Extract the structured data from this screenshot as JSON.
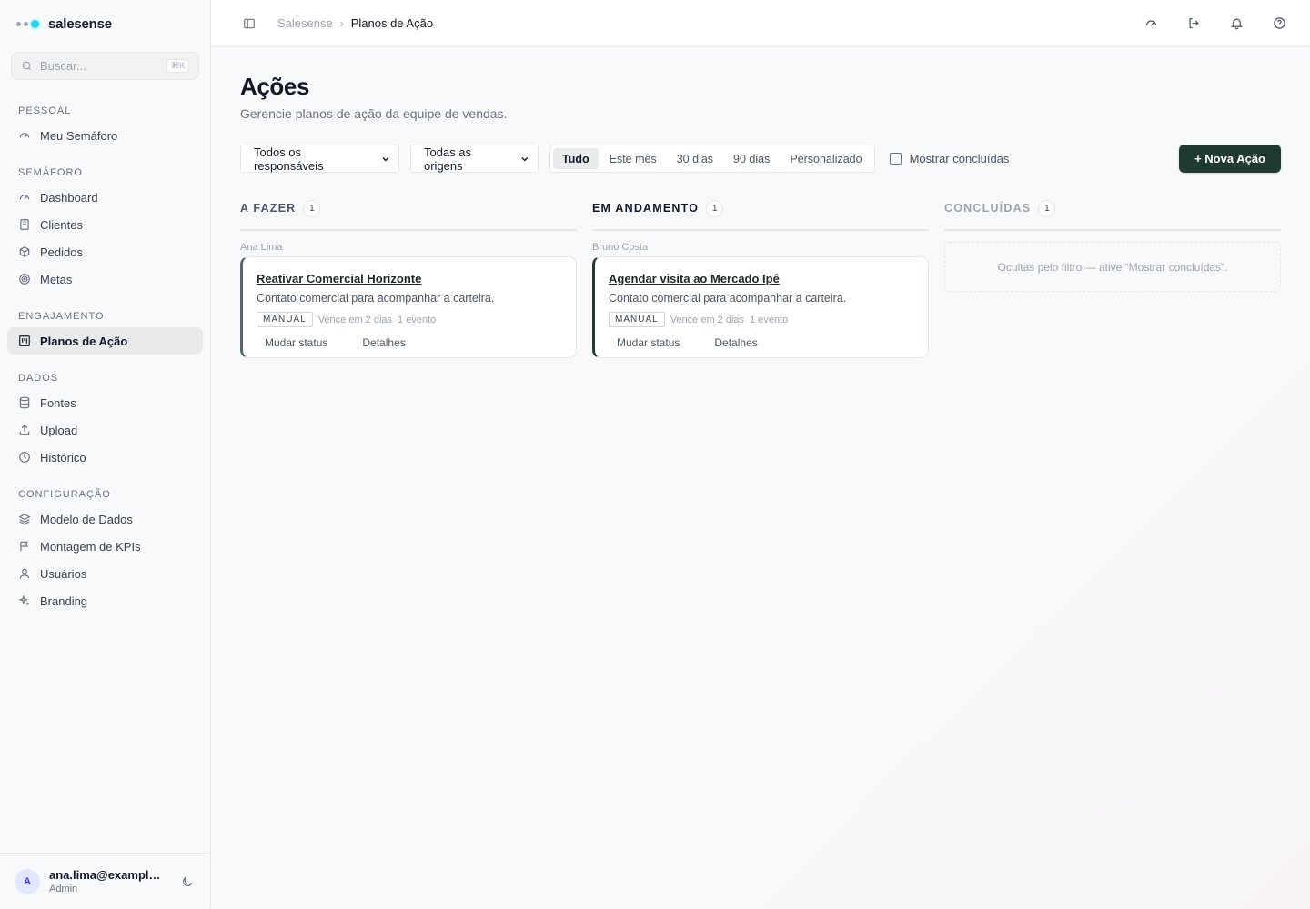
{
  "brand": {
    "name": "salesense"
  },
  "search": {
    "placeholder": "Buscar...",
    "shortcut": "⌘K"
  },
  "sidebar": {
    "sections": [
      {
        "title": "PESSOAL",
        "items": [
          {
            "label": "Meu Semáforo",
            "icon": "gauge-icon"
          }
        ]
      },
      {
        "title": "SEMÁFORO",
        "items": [
          {
            "label": "Dashboard",
            "icon": "gauge-icon"
          },
          {
            "label": "Clientes",
            "icon": "building-icon"
          },
          {
            "label": "Pedidos",
            "icon": "package-icon"
          },
          {
            "label": "Metas",
            "icon": "target-icon"
          }
        ]
      },
      {
        "title": "ENGAJAMENTO",
        "items": [
          {
            "label": "Planos de Ação",
            "icon": "kanban-icon",
            "active": true
          }
        ]
      },
      {
        "title": "DADOS",
        "items": [
          {
            "label": "Fontes",
            "icon": "database-icon"
          },
          {
            "label": "Upload",
            "icon": "upload-icon"
          },
          {
            "label": "Histórico",
            "icon": "clock-icon"
          }
        ]
      },
      {
        "title": "CONFIGURAÇÃO",
        "items": [
          {
            "label": "Modelo de Dados",
            "icon": "layers-icon"
          },
          {
            "label": "Montagem de KPIs",
            "icon": "flag-icon"
          },
          {
            "label": "Usuários",
            "icon": "user-icon"
          },
          {
            "label": "Branding",
            "icon": "sparkles-icon"
          }
        ]
      }
    ]
  },
  "user": {
    "initial": "A",
    "email": "ana.lima@example.com",
    "role": "Admin"
  },
  "breadcrumb": {
    "root": "Salesense",
    "current": "Planos de Ação"
  },
  "page": {
    "title": "Ações",
    "subtitle": "Gerencie planos de ação da equipe de vendas."
  },
  "filters": {
    "owner": "Todos os responsáveis",
    "origin": "Todas as origens",
    "periods": [
      "Tudo",
      "Este mês",
      "30 dias",
      "90 dias",
      "Personalizado"
    ],
    "period_active": "Tudo",
    "show_done_label": "Mostrar concluídas",
    "new_button": "+ Nova Ação"
  },
  "board": {
    "todo": {
      "title": "A FAZER",
      "count": "1",
      "owner": "Ana Lima",
      "card": {
        "title": "Reativar Comercial Horizonte",
        "desc": "Contato comercial para acompanhar a carteira.",
        "tag": "MANUAL",
        "due": "Vence em 2 dias",
        "events": "1 evento",
        "change_status": "Mudar status",
        "details": "Detalhes"
      }
    },
    "doing": {
      "title": "EM ANDAMENTO",
      "count": "1",
      "owner": "Bruno Costa",
      "card": {
        "title": "Agendar visita ao Mercado Ipê",
        "desc": "Contato comercial para acompanhar a carteira.",
        "tag": "MANUAL",
        "due": "Vence em 2 dias",
        "events": "1 evento",
        "change_status": "Mudar status",
        "details": "Detalhes"
      }
    },
    "done": {
      "title": "CONCLUÍDAS",
      "count": "1",
      "empty_text": "Ocultas pelo filtro — ative “Mostrar concluídas”."
    }
  },
  "colors": {
    "accent": "#1f3a2e",
    "brand_dot": "#22d3ee"
  }
}
